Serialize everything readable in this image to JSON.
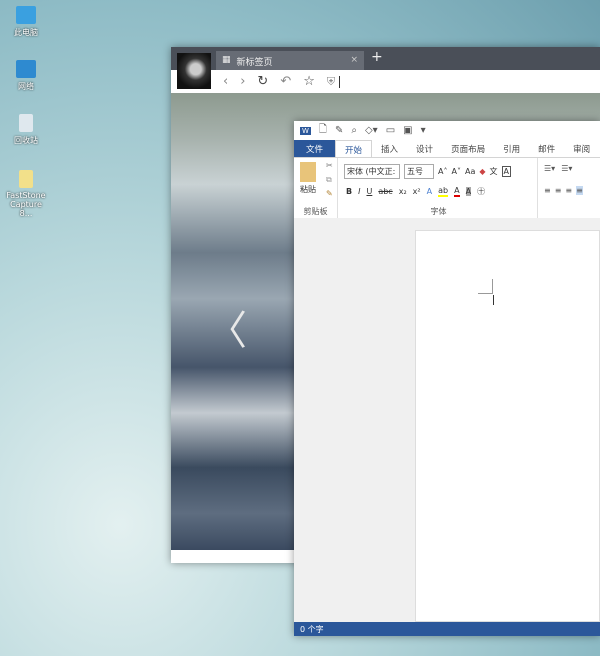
{
  "desktop": {
    "icons": [
      {
        "label": "此电脑",
        "color": "#3aa0e0"
      },
      {
        "label": "网络",
        "color": "#2e8ad0"
      },
      {
        "label": "回收站",
        "color": "#dfe8ee"
      },
      {
        "label": "FastStone Capture 8...",
        "color": "#f2e08a"
      }
    ]
  },
  "browser": {
    "tab_title": "新标签页",
    "tab_close": "×",
    "new_tab": "+",
    "nav": {
      "back": "‹",
      "forward": "›",
      "reload": "↻",
      "undo": "↶",
      "favorite": "☆",
      "shield": "⛨"
    }
  },
  "word": {
    "tabs": [
      "文件",
      "开始",
      "插入",
      "设计",
      "页面布局",
      "引用",
      "邮件",
      "审阅"
    ],
    "clipboard": {
      "paste": "粘贴",
      "label": "剪贴板"
    },
    "font": {
      "name": "宋体 (中文正:",
      "size": "五号",
      "label": "字体",
      "bold": "B",
      "italic": "I",
      "underline": "U",
      "strike": "abc",
      "sub": "x₂",
      "sup": "x²",
      "grow": "A˄",
      "shrink": "A˅",
      "case": "Aa"
    },
    "status": "0 个字",
    "accent": "#2b579a"
  }
}
